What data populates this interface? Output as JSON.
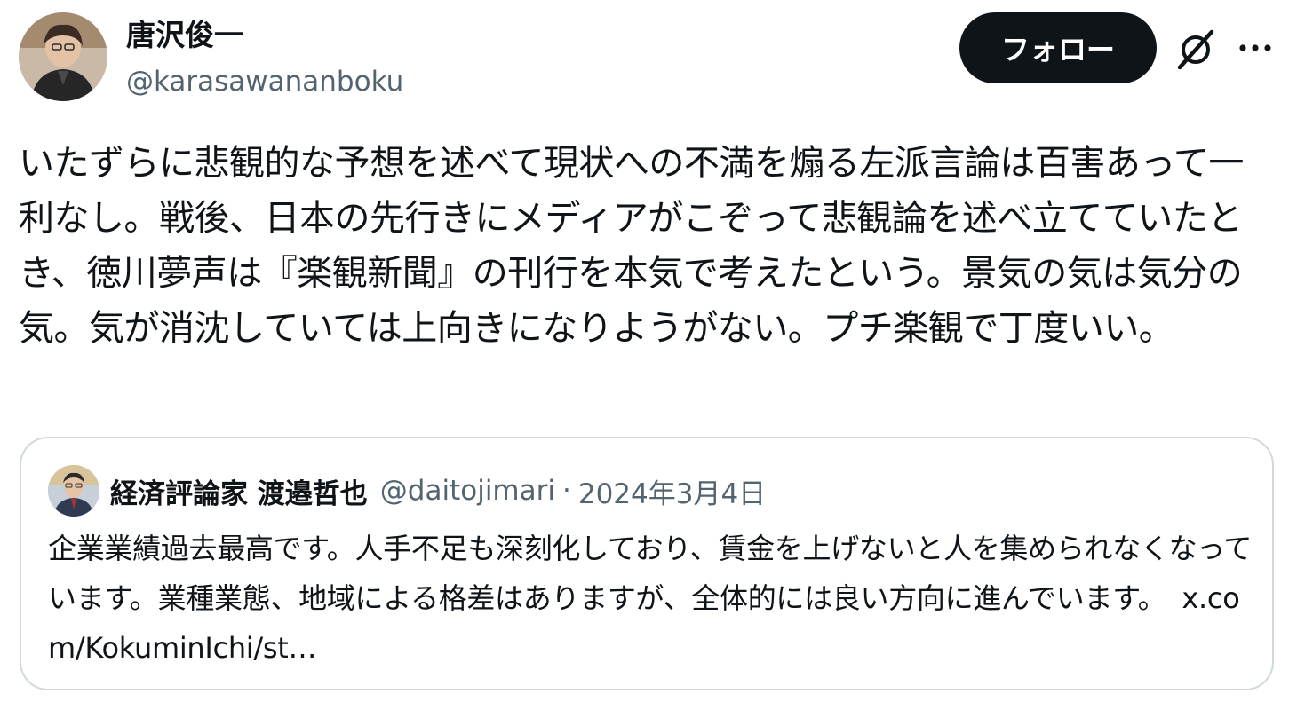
{
  "author": {
    "name": "唐沢俊一",
    "handle": "@karasawananboku"
  },
  "header": {
    "follow_label": "フォロー"
  },
  "tweet": {
    "text": "いたずらに悲観的な予想を述べて現状への不満を煽る左派言論は百害あって一利なし。戦後、日本の先行きにメディアがこぞって悲観論を述べ立てていたとき、徳川夢声は『楽観新聞』の刊行を本気で考えたという。景気の気は気分の気。気が消沈していては上向きになりようがない。プチ楽観で丁度いい。"
  },
  "quote": {
    "name": "経済評論家 渡邉哲也",
    "handle": "@daitojimari",
    "separator": "·",
    "date": "2024年3月4日",
    "text": "企業業績過去最高です。人手不足も深刻化しており、賃金を上げないと人を集められなくなっています。業種業態、地域による格差はありますが、全体的には良い方向に進んでいます。",
    "link": "x.com/KokuminIchi/st…"
  },
  "icons": {
    "grok": "grok-icon",
    "more": "more-icon"
  }
}
